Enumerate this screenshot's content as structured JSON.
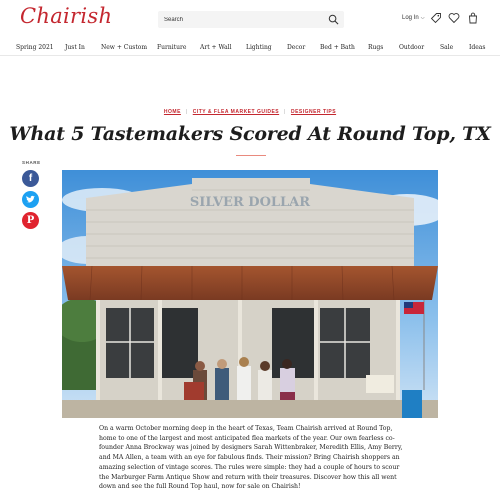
{
  "header": {
    "logo": "Chairish",
    "search_placeholder": "Search",
    "login_label": "Log In",
    "icons": [
      "search-icon",
      "tag-icon",
      "heart-icon",
      "cart-icon"
    ]
  },
  "nav": {
    "items": [
      "Spring 2021",
      "Just In",
      "New + Custom",
      "Furniture",
      "Art + Wall",
      "Lighting",
      "Decor",
      "Bed + Bath",
      "Rugs",
      "Outdoor",
      "Sale",
      "Ideas"
    ]
  },
  "breadcrumb": {
    "items": [
      "HOME",
      "CITY & FLEA MARKET GUIDES",
      "DESIGNER TIPS"
    ]
  },
  "article": {
    "title": "What 5 Tastemakers Scored At Round Top, TX",
    "share_label": "SHARE",
    "share_buttons": [
      "facebook-icon",
      "twitter-icon",
      "pinterest-icon"
    ],
    "photo_sign": "SILVER DOLLAR",
    "body": "On a warm October morning deep in the heart of Texas, Team Chairish arrived at Round Top, home to one of the largest and most anticipated flea markets of the year. Our own fearless co-founder Anna Brockway was joined by designers Sarah Wittenbraker, Meredith Ellis, Amy Berry, and MA Allen, a team with an eye for fabulous finds. Their mission? Bring Chairish shoppers an amazing selection of vintage scores. The rules were simple: they had a couple of hours to scour the Marburger Farm Antique Show and return with their treasures. Discover how this all went down and see the full Round Top haul, now for sale on Chairish!"
  },
  "colors": {
    "brand": "#c4272f",
    "facebook": "#3b5998",
    "twitter": "#1da1f2",
    "pinterest": "#e0242f"
  }
}
